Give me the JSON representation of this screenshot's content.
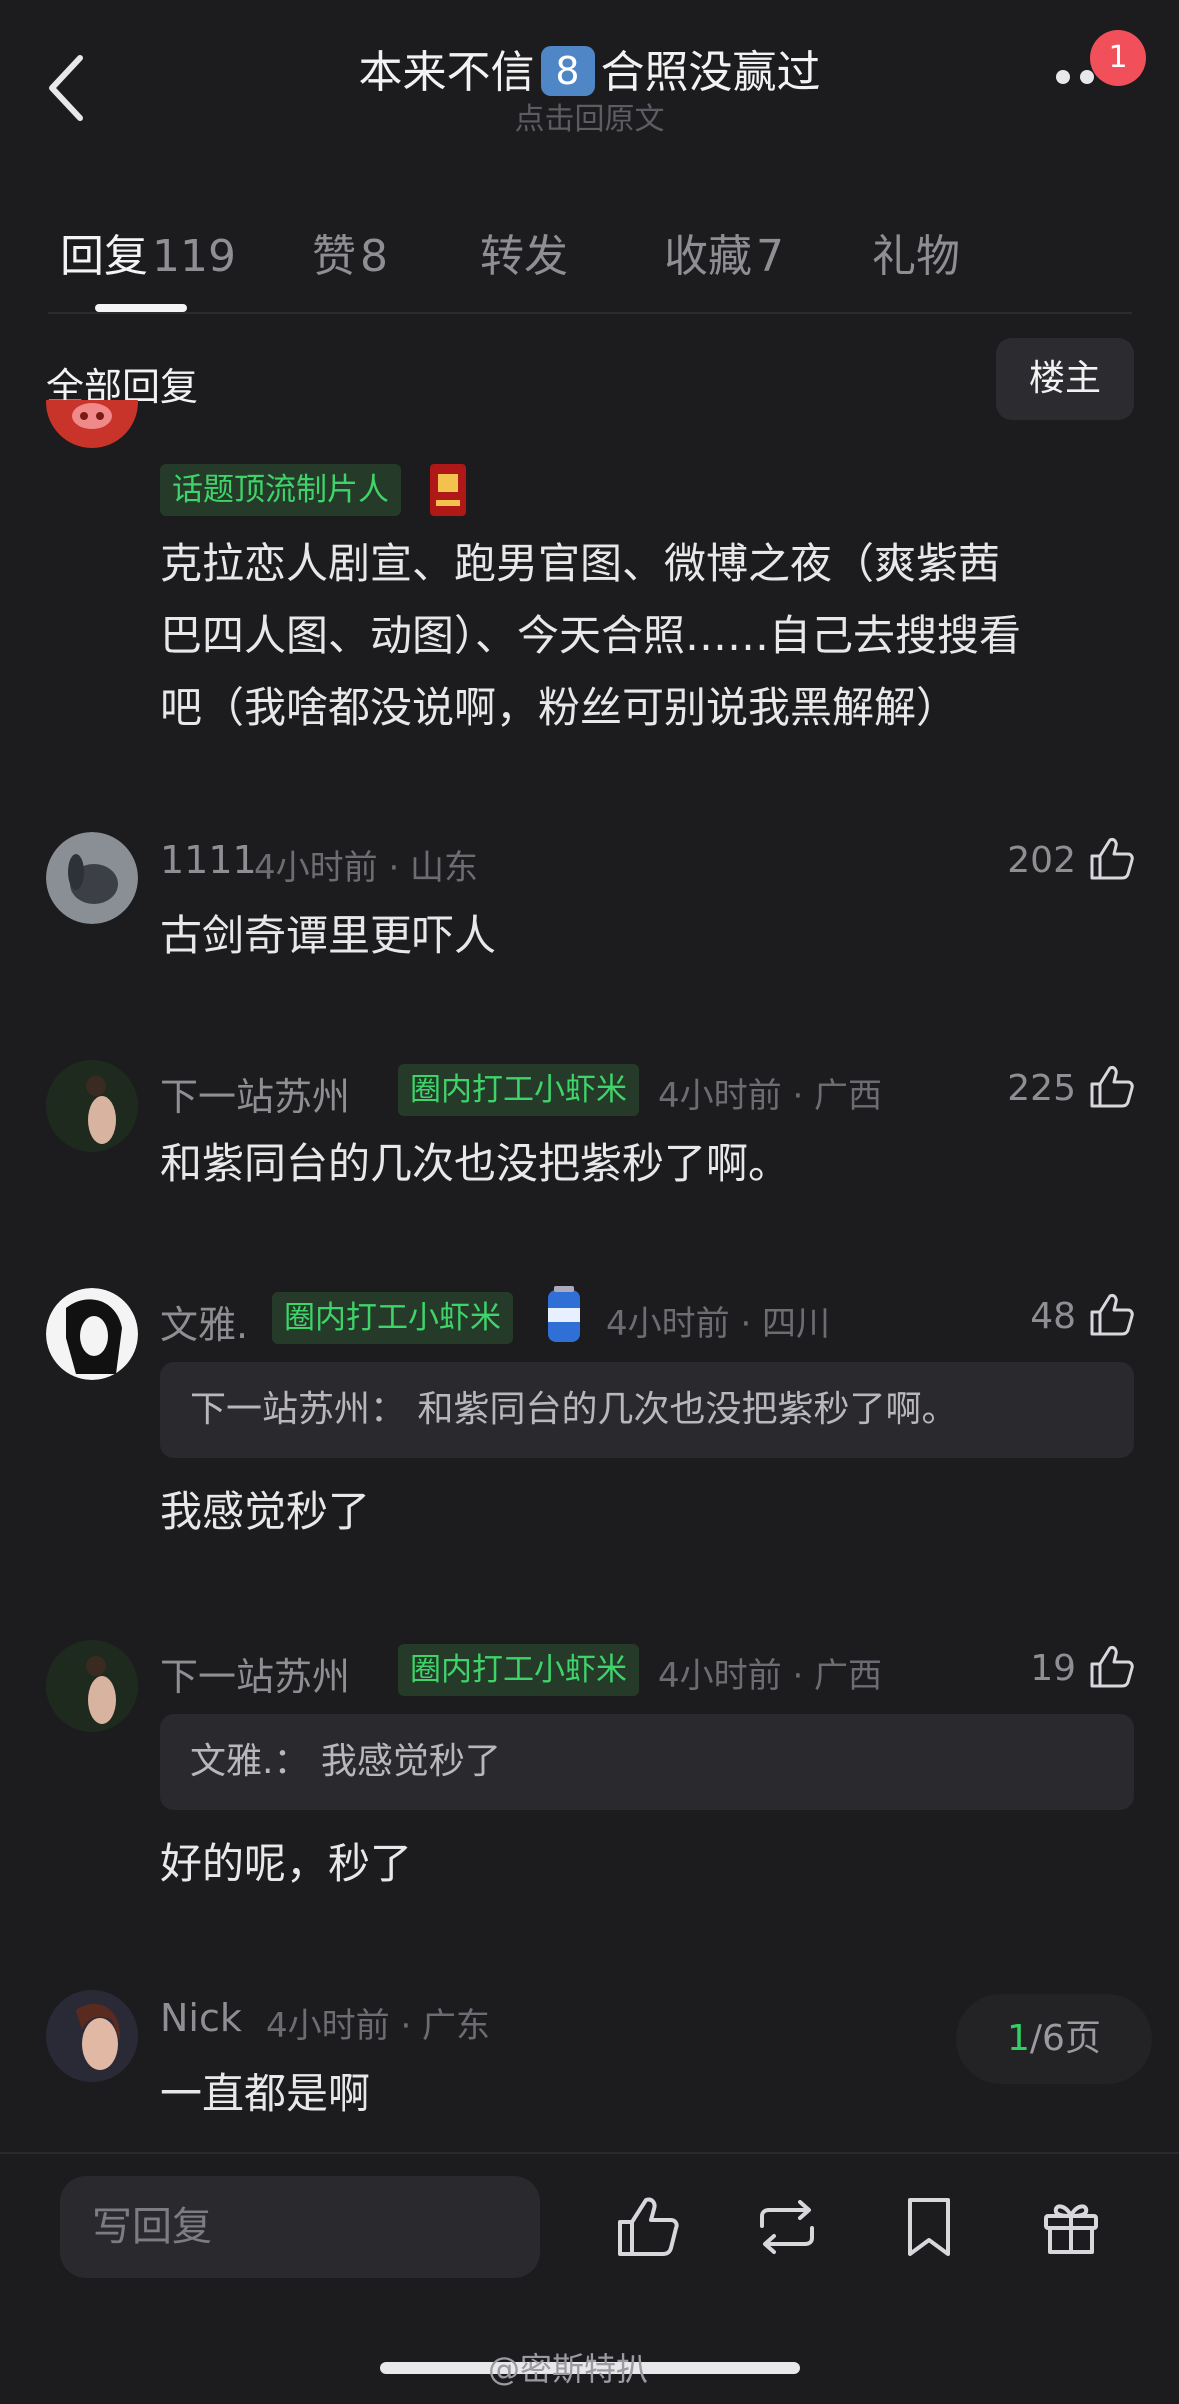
{
  "header": {
    "title_pre": "本来不信",
    "title_keycap": "8",
    "title_post": "合照没赢过",
    "subtitle": "点击回原文",
    "notification_count": "1"
  },
  "tabs": [
    {
      "label": "回复",
      "count": "119"
    },
    {
      "label": "赞",
      "count": "8"
    },
    {
      "label": "转发",
      "count": ""
    },
    {
      "label": "收藏",
      "count": "7"
    },
    {
      "label": "礼物",
      "count": ""
    }
  ],
  "section": {
    "title": "全部回复",
    "owner_button": "楼主"
  },
  "comments": [
    {
      "tag": "话题顶流制片人",
      "lines": [
        "克拉恋人剧宣、跑男官图、微博之夜（爽紫茜",
        "巴四人图、动图）、今天合照……自己去搜搜看",
        "吧（我啥都没说啊，粉丝可别说我黑解解）"
      ]
    },
    {
      "name": "1111",
      "meta": "4小时前 · 山东",
      "likes": "202",
      "body": "古剑奇谭里更吓人"
    },
    {
      "name": "下一站苏州",
      "tag": "圈内打工小虾米",
      "meta": "4小时前 · 广西",
      "likes": "225",
      "body": "和紫同台的几次也没把紫秒了啊。"
    },
    {
      "name": "文雅.",
      "tag": "圈内打工小虾米",
      "meta": "4小时前 · 四川",
      "likes": "48",
      "quote": "下一站苏州： 和紫同台的几次也没把紫秒了啊。",
      "body": "我感觉秒了"
    },
    {
      "name": "下一站苏州",
      "tag": "圈内打工小虾米",
      "meta": "4小时前 · 广西",
      "likes": "19",
      "quote": "文雅.：  我感觉秒了",
      "body": "好的呢，秒了"
    },
    {
      "name": "Nick",
      "meta": "4小时前 · 广东",
      "body": "一直都是啊"
    }
  ],
  "pagination": {
    "current": "1",
    "total": "/6页"
  },
  "bottom_bar": {
    "reply_placeholder": "写回复"
  },
  "watermark": "@密斯特扒",
  "colors": {
    "background": "#1c1c1f",
    "tag_green": "#3fd46a",
    "badge_red": "#f1505a"
  }
}
